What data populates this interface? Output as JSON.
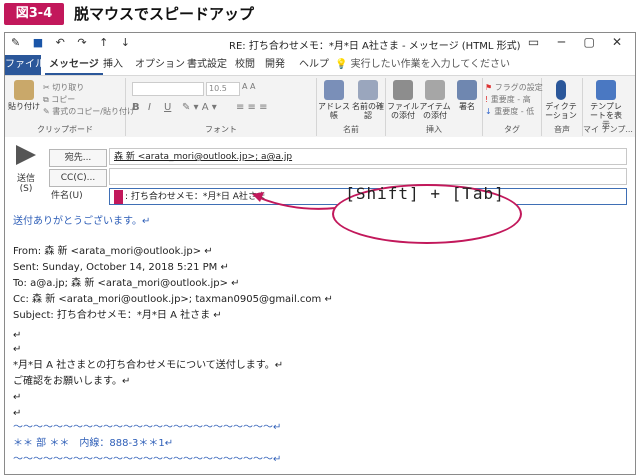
{
  "figure": {
    "badge": "図3-4",
    "title": "脱マウスでスピードアップ"
  },
  "window": {
    "title": "RE: 打ち合わせメモ：*月*日 A社さま  -  メッセージ (HTML 形式)",
    "qat": [
      "✎",
      "■",
      "↶",
      "↷",
      "↑",
      "↓"
    ],
    "controls": [
      "▭",
      "─",
      "▢",
      "✕"
    ]
  },
  "tabs": [
    "ファイル",
    "メッセージ",
    "挿入",
    "オプション",
    "書式設定",
    "校閲",
    "開発",
    "ヘルプ"
  ],
  "tellme": "実行したい作業を入力してください",
  "ribbon": {
    "clipboard": {
      "paste": "貼り付け",
      "cut": "切り取り",
      "copy": "コピー",
      "format_painter": "書式のコピー/貼り付け",
      "label": "クリップボード"
    },
    "font": {
      "size": "10.5",
      "label": "フォント"
    },
    "names": {
      "address_book": "アドレス帳",
      "check_names": "名前の確認",
      "label": "名前"
    },
    "include": {
      "attach_file": "ファイルの添付",
      "attach_item": "アイテムの添付",
      "signature": "署名",
      "label": "挿入"
    },
    "tags": {
      "followup": "フラグの設定",
      "high": "重要度 - 高",
      "low": "重要度 - 低",
      "label": "タグ"
    },
    "voice": {
      "dictate": "ディクテーション",
      "label": "音声"
    },
    "templates": {
      "view": "テンプレートを表示",
      "label": "マイ テンプ..."
    }
  },
  "compose": {
    "send": "送信(S)",
    "to_button": "宛先...",
    "cc_button": "CC(C)...",
    "subject_label": "件名(U)",
    "to_name": "森 新 <arata_mori@outlook.jp>",
    "to_rest": "; a@a.jp",
    "cc_value": "",
    "subject_value": ": 打ち合わせメモ：*月*日 A社さま"
  },
  "callout": "[Shift] + [Tab]",
  "body": {
    "greeting": "送付ありがとうございます。↵",
    "from": "From: 森 新 <arata_mori@outlook.jp> ↵",
    "sent": "Sent: Sunday, October 14, 2018 5:21 PM ↵",
    "to": "To: a@a.jp; 森 新 <arata_mori@outlook.jp> ↵",
    "cc": "Cc: 森 新 <arata_mori@outlook.jp>; taxman0905@gmail.com ↵",
    "subject": "Subject: 打ち合わせメモ：*月*日 A 社さま ↵",
    "line1": "*月*日 A 社さまとの打ち合わせメモについて送付します。↵",
    "line2": "ご確認をお願いします。↵",
    "wave": "〜〜〜〜〜〜〜〜〜〜〜〜〜〜〜〜〜〜〜〜〜〜〜〜〜〜↵",
    "sig": "＊＊ 部 ＊＊　内線：888-3＊＊1↵",
    "wave2": "〜〜〜〜〜〜〜〜〜〜〜〜〜〜〜〜〜〜〜〜〜〜〜〜〜〜↵",
    "empty": "↵"
  },
  "colors": {
    "accent": "#c2185b",
    "office_blue": "#2b579a",
    "body_blue": "#2f5fb8"
  }
}
